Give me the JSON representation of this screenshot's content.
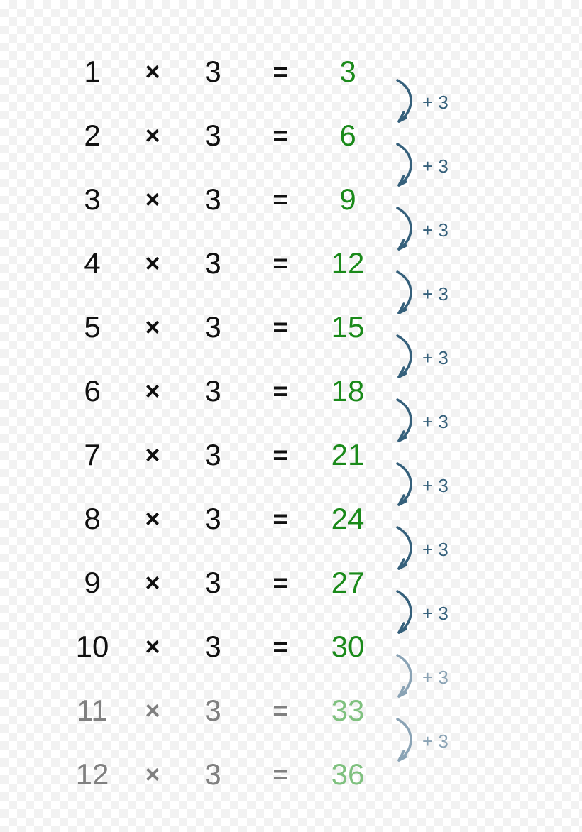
{
  "factor": 3,
  "operator": "×",
  "equals": "=",
  "step_label": "+ 3",
  "rows": [
    {
      "a": "1",
      "b": "3",
      "r": "3",
      "faded": false
    },
    {
      "a": "2",
      "b": "3",
      "r": "6",
      "faded": false
    },
    {
      "a": "3",
      "b": "3",
      "r": "9",
      "faded": false
    },
    {
      "a": "4",
      "b": "3",
      "r": "12",
      "faded": false
    },
    {
      "a": "5",
      "b": "3",
      "r": "15",
      "faded": false
    },
    {
      "a": "6",
      "b": "3",
      "r": "18",
      "faded": false
    },
    {
      "a": "7",
      "b": "3",
      "r": "21",
      "faded": false
    },
    {
      "a": "8",
      "b": "3",
      "r": "24",
      "faded": false
    },
    {
      "a": "9",
      "b": "3",
      "r": "27",
      "faded": false
    },
    {
      "a": "10",
      "b": "3",
      "r": "30",
      "faded": false
    },
    {
      "a": "11",
      "b": "3",
      "r": "33",
      "faded": true
    },
    {
      "a": "12",
      "b": "3",
      "r": "36",
      "faded": true
    }
  ],
  "steps": [
    {
      "between": [
        0,
        1
      ],
      "faded": false
    },
    {
      "between": [
        1,
        2
      ],
      "faded": false
    },
    {
      "between": [
        2,
        3
      ],
      "faded": false
    },
    {
      "between": [
        3,
        4
      ],
      "faded": false
    },
    {
      "between": [
        4,
        5
      ],
      "faded": false
    },
    {
      "between": [
        5,
        6
      ],
      "faded": false
    },
    {
      "between": [
        6,
        7
      ],
      "faded": false
    },
    {
      "between": [
        7,
        8
      ],
      "faded": false
    },
    {
      "between": [
        8,
        9
      ],
      "faded": false
    },
    {
      "between": [
        9,
        10
      ],
      "faded": true
    },
    {
      "between": [
        10,
        11
      ],
      "faded": true
    }
  ]
}
